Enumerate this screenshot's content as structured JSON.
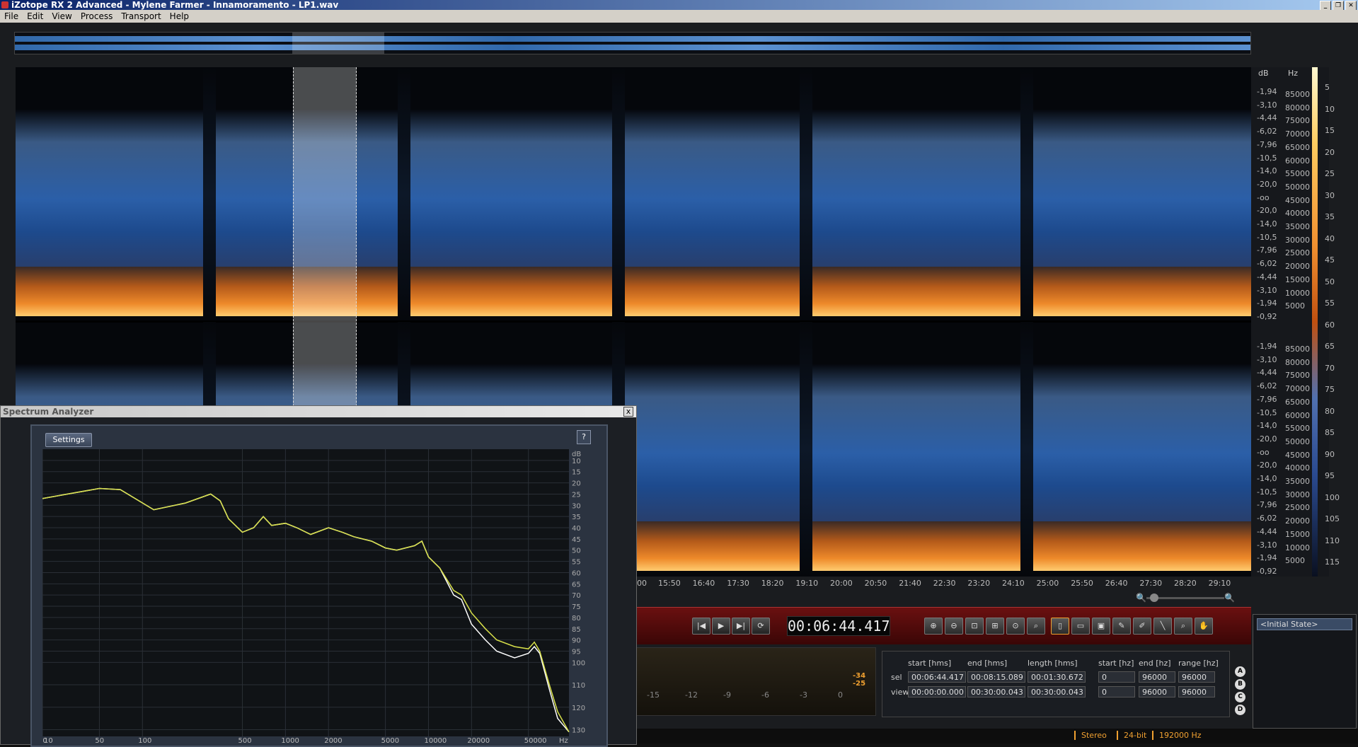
{
  "window": {
    "title": "iZotope RX 2 Advanced - Mylene Farmer - Innamoramento - LP1.wav"
  },
  "menu": [
    "File",
    "Edit",
    "View",
    "Process",
    "Transport",
    "Help"
  ],
  "scale": {
    "db_header": "dB",
    "hz_header": "Hz",
    "db_labels_top": [
      "-1,94",
      "-3,10",
      "-4,44",
      "-6,02",
      "-7,96",
      "-10,5",
      "-14,0",
      "-20,0",
      "-oo",
      "-20,0",
      "-14,0",
      "-10,5",
      "-7,96",
      "-6,02",
      "-4,44",
      "-3,10",
      "-1,94",
      "-0,92"
    ],
    "hz_labels_top": [
      "85000",
      "80000",
      "75000",
      "70000",
      "65000",
      "60000",
      "55000",
      "50000",
      "45000",
      "40000",
      "35000",
      "30000",
      "25000",
      "20000",
      "15000",
      "10000",
      "5000"
    ],
    "db_labels_bot": [
      "-1,94",
      "-3,10",
      "-4,44",
      "-6,02",
      "-7,96",
      "-10,5",
      "-14,0",
      "-20,0",
      "-oo",
      "-20,0",
      "-14,0",
      "-10,5",
      "-7,96",
      "-6,02",
      "-4,44",
      "-3,10",
      "-1,94",
      "-0,92"
    ],
    "hz_labels_bot": [
      "85000",
      "80000",
      "75000",
      "70000",
      "65000",
      "60000",
      "55000",
      "50000",
      "45000",
      "40000",
      "35000",
      "30000",
      "25000",
      "20000",
      "15000",
      "10000",
      "5000"
    ],
    "colorbar_labels": [
      "5",
      "10",
      "15",
      "20",
      "25",
      "30",
      "35",
      "40",
      "45",
      "50",
      "55",
      "60",
      "65",
      "70",
      "75",
      "80",
      "85",
      "90",
      "95",
      "100",
      "105",
      "110",
      "115"
    ]
  },
  "timeaxis": [
    "00",
    "15:50",
    "16:40",
    "17:30",
    "18:20",
    "19:10",
    "20:00",
    "20:50",
    "21:40",
    "22:30",
    "23:20",
    "24:10",
    "25:00",
    "25:50",
    "26:40",
    "27:30",
    "28:20",
    "29:10"
  ],
  "transport": {
    "timecode": "00:06:44.417"
  },
  "meter": {
    "ticks": [
      "-15",
      "-12",
      "-9",
      "-6",
      "-3",
      "0"
    ],
    "peak_top": "-34",
    "peak_bot": "-25"
  },
  "selection": {
    "headers": [
      "start [hms]",
      "end [hms]",
      "length [hms]",
      "start [hz]",
      "end [hz]",
      "range [hz]"
    ],
    "rows": [
      {
        "label": "sel",
        "values": [
          "00:06:44.417",
          "00:08:15.089",
          "00:01:30.672",
          "0",
          "96000",
          "96000"
        ]
      },
      {
        "label": "view",
        "values": [
          "00:00:00.000",
          "00:30:00.043",
          "00:30:00.043",
          "0",
          "96000",
          "96000"
        ]
      }
    ]
  },
  "snapshots": [
    "A",
    "B",
    "C",
    "D"
  ],
  "history": {
    "item": "<Initial State>"
  },
  "status": {
    "channels": "Stereo",
    "bitdepth": "24-bit",
    "samplerate": "192000 Hz"
  },
  "spectrum_analyzer": {
    "title": "Spectrum Analyzer",
    "settings_label": "Settings",
    "help_label": "?",
    "close_label": "x"
  },
  "chart_data": {
    "type": "line",
    "xscale": "log",
    "ylabel": "dB",
    "xunit": "Hz",
    "x_ticks": [
      20,
      50,
      100,
      500,
      1000,
      2000,
      5000,
      10000,
      20000,
      50000
    ],
    "x_tick_labels": [
      "20",
      "50",
      "100",
      "500",
      "1000",
      "2000",
      "5000",
      "10000",
      "20000",
      "50000"
    ],
    "x_left_label": "10",
    "y_ticks": [
      10,
      15,
      20,
      25,
      30,
      35,
      40,
      45,
      50,
      55,
      60,
      65,
      70,
      75,
      80,
      85,
      90,
      95,
      100,
      110,
      120,
      130
    ],
    "ylim": [
      5,
      133
    ],
    "xlim": [
      20,
      96000
    ],
    "series": [
      {
        "color": "#d8e04a",
        "x": [
          20,
          30,
          50,
          70,
          120,
          200,
          300,
          350,
          400,
          500,
          600,
          700,
          800,
          1000,
          1200,
          1500,
          2000,
          2500,
          3000,
          4000,
          5000,
          6000,
          8000,
          9000,
          10000,
          12000,
          15000,
          17000,
          20000,
          25000,
          30000,
          40000,
          50000,
          55000,
          60000,
          70000,
          80000,
          96000
        ],
        "y": [
          27,
          25,
          22.5,
          23,
          32,
          29,
          25,
          28,
          36,
          42,
          40,
          35,
          39,
          38,
          40,
          43,
          40,
          42,
          44,
          46,
          49,
          50,
          48,
          46,
          53,
          58,
          68,
          70,
          78,
          85,
          90,
          93,
          94,
          91,
          95,
          110,
          122,
          131
        ]
      },
      {
        "color": "#ffffff",
        "x": [
          20,
          30,
          50,
          70,
          120,
          200,
          300,
          350,
          400,
          500,
          600,
          700,
          800,
          1000,
          1200,
          1500,
          2000,
          2500,
          3000,
          4000,
          5000,
          6000,
          8000,
          9000,
          10000,
          12000,
          15000,
          17000,
          20000,
          25000,
          30000,
          40000,
          50000,
          55000,
          60000,
          70000,
          80000,
          96000
        ],
        "y": [
          27,
          25,
          22.5,
          23,
          32,
          29,
          25,
          28,
          36,
          42,
          40,
          35,
          39,
          38,
          40,
          43,
          40,
          42,
          44,
          46,
          49,
          50,
          48,
          46,
          53,
          58,
          70,
          72,
          83,
          90,
          95,
          98,
          96,
          93,
          96,
          112,
          125,
          131
        ]
      }
    ]
  }
}
